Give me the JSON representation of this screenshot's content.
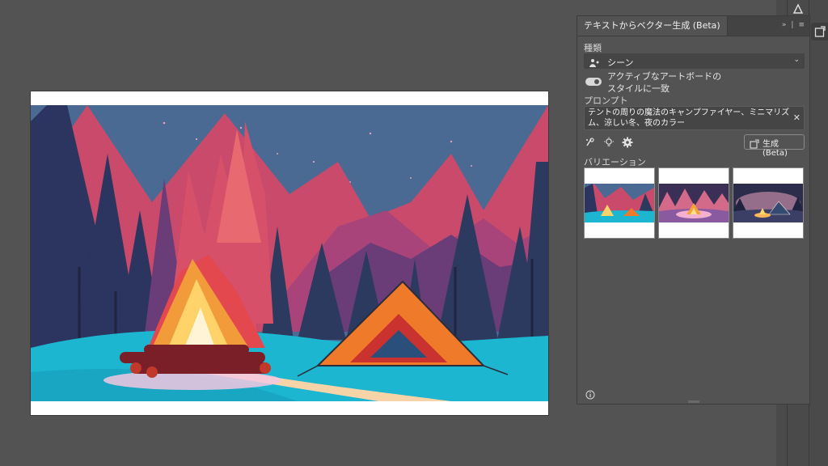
{
  "panel": {
    "title": "テキストからベクター生成 (Beta)",
    "type_label": "種類",
    "type_value": "シーン",
    "match_style_label": "アクティブなアートボードのスタイルに一致",
    "match_style_on": true,
    "prompt_label": "プロンプト",
    "prompt_text": "テントの周りの魔法のキャンプファイヤー、ミニマリズム、涼しい冬、夜のカラー",
    "generate_label": "生成 (Beta)",
    "variations_label": "バリエーション"
  },
  "icons": {
    "panel_collapse": "double-chevron-icon",
    "panel_menu": "hamburger-icon",
    "scene_type": "scene-icon",
    "dropdown": "chevron-down-icon",
    "clear_prompt": "close-icon",
    "sample_prompts": "sample-prompt-icon",
    "tips": "lightbulb-icon",
    "settings": "gear-icon",
    "generate": "generate-icon",
    "info": "info-icon"
  },
  "colors": {
    "sky": "#4a6a94",
    "mountain_pink": "#d6506a",
    "tree_navy": "#2d3a60",
    "snow": "#1cb6d0",
    "tent_orange": "#ef7a2a",
    "fire_yellow": "#ffd36a"
  }
}
